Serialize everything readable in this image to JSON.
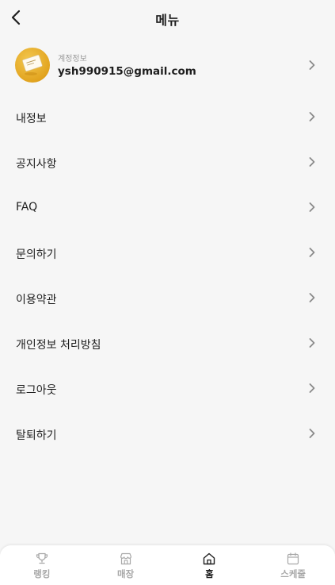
{
  "header": {
    "title": "메뉴",
    "back_icon": "chevron-left-icon"
  },
  "account": {
    "label": "계정정보",
    "email": "ysh990915@gmail.com"
  },
  "menu": {
    "items": [
      {
        "label": "내정보"
      },
      {
        "label": "공지사항"
      },
      {
        "label": "FAQ"
      },
      {
        "label": "문의하기"
      },
      {
        "label": "이용약관"
      },
      {
        "label": "개인정보 처리방침"
      },
      {
        "label": "로그아웃"
      },
      {
        "label": "탈퇴하기"
      }
    ]
  },
  "tabbar": {
    "tabs": [
      {
        "label": "랭킹",
        "icon": "trophy-icon",
        "active": false
      },
      {
        "label": "매장",
        "icon": "store-icon",
        "active": false
      },
      {
        "label": "홈",
        "icon": "home-icon",
        "active": true
      },
      {
        "label": "스케줄",
        "icon": "calendar-icon",
        "active": false
      }
    ]
  },
  "colors": {
    "background": "#f6f6f6",
    "text": "#1e1e1e",
    "muted": "#9a9a9a",
    "inactive_tab": "#a8a8a8",
    "avatar": "#e2a41f"
  }
}
